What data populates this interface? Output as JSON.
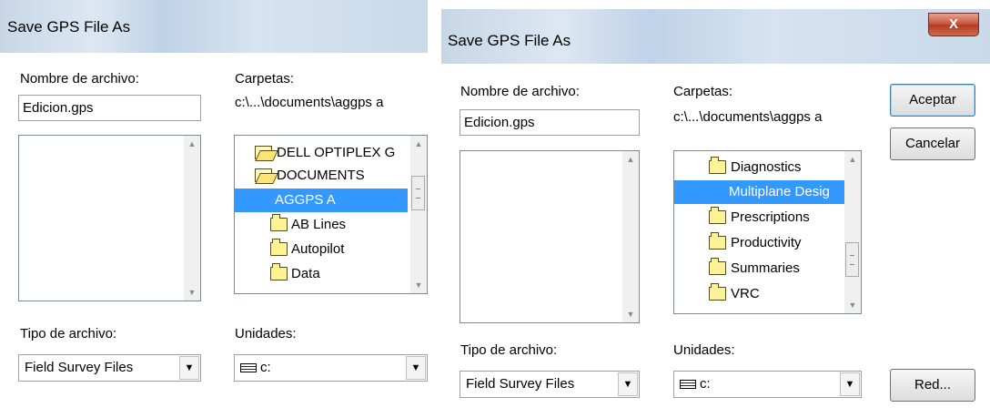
{
  "dialog1": {
    "title": "Save GPS File As",
    "filename_label": "Nombre de archivo:",
    "filename_value": "Edicion.gps",
    "folders_label": "Carpetas:",
    "current_path": "c:\\...\\documents\\aggps a",
    "folders": [
      {
        "name": "DELL OPTIPLEX G",
        "icon": "open-folder-icon",
        "selected": false
      },
      {
        "name": "DOCUMENTS",
        "icon": "open-folder-icon",
        "selected": false
      },
      {
        "name": "AGGPS A",
        "icon": "open-folder-icon",
        "selected": true
      },
      {
        "name": "AB Lines",
        "icon": "folder-icon",
        "selected": false
      },
      {
        "name": "Autopilot",
        "icon": "folder-icon",
        "selected": false
      },
      {
        "name": "Data",
        "icon": "folder-icon",
        "selected": false
      }
    ],
    "filetype_label": "Tipo de archivo:",
    "filetype_value": "Field Survey Files",
    "drives_label": "Unidades:",
    "drive_value": "c:"
  },
  "dialog2": {
    "title": "Save GPS File As",
    "close_glyph": "X",
    "filename_label": "Nombre de archivo:",
    "filename_value": "Edicion.gps",
    "folders_label": "Carpetas:",
    "current_path": "c:\\...\\documents\\aggps a",
    "folders": [
      {
        "name": "Diagnostics",
        "icon": "folder-icon",
        "selected": false
      },
      {
        "name": "Multiplane Desig",
        "icon": "folder-icon",
        "selected": true
      },
      {
        "name": "Prescriptions",
        "icon": "folder-icon",
        "selected": false
      },
      {
        "name": "Productivity",
        "icon": "folder-icon",
        "selected": false
      },
      {
        "name": "Summaries",
        "icon": "folder-icon",
        "selected": false
      },
      {
        "name": "VRC",
        "icon": "folder-icon",
        "selected": false
      }
    ],
    "filetype_label": "Tipo de archivo:",
    "filetype_value": "Field Survey Files",
    "drives_label": "Unidades:",
    "drive_value": "c:",
    "ok_label": "Aceptar",
    "cancel_label": "Cancelar",
    "network_label": "Red..."
  },
  "colors": {
    "selection": "#3399ff",
    "titlebar": "#c7d6e6",
    "close_button": "#c8533c"
  }
}
